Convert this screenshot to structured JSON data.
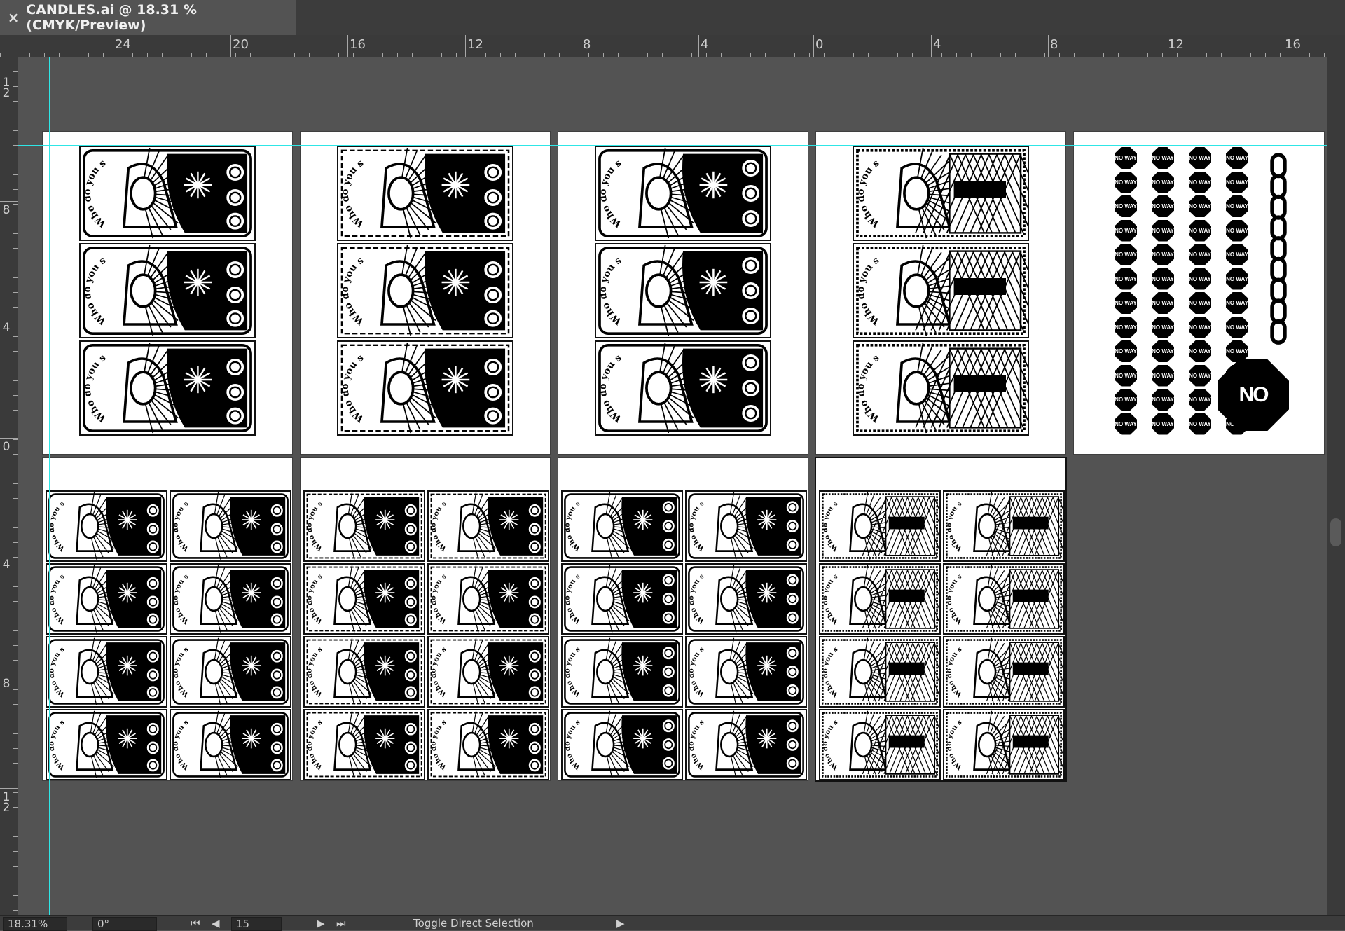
{
  "document_tab": {
    "close_glyph": "×",
    "title": "CANDLES.ai @ 18.31 % (CMYK/Preview)"
  },
  "ruler_horizontal": [
    "24",
    "20",
    "16",
    "12",
    "8",
    "4",
    "0",
    "4",
    "8",
    "12",
    "16"
  ],
  "ruler_vertical": [
    "1\n2",
    "8",
    "4",
    "0",
    "4",
    "8",
    "1\n2"
  ],
  "artboards": {
    "card_caption": "Who do you say that I am?",
    "sticker_label": "NO WAY",
    "stop_sign_label": "NO WAY"
  },
  "statusbar": {
    "zoom": "18.31%",
    "rotation": "0°",
    "artboard_number": "15",
    "tool_hint": "Toggle Direct Selection"
  },
  "colors": {
    "guide": "#2ee6e6",
    "canvas": "#535353",
    "artboard": "#ffffff"
  }
}
